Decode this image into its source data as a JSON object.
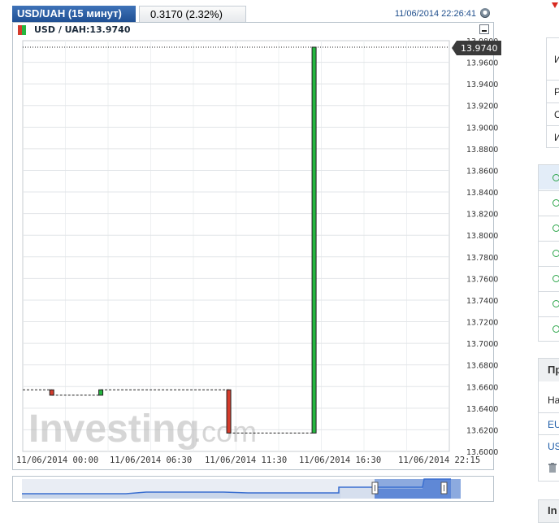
{
  "header": {
    "pair_tab": "USD/UAH (15 минут)",
    "change_tab": "0.3170 (2.32%)",
    "timestamp": "11/06/2014 22:26:41"
  },
  "legend": {
    "label": "USD / UAH:13.9740"
  },
  "price_badge": "13.9740",
  "watermark": {
    "brand": "Investing",
    "suffix": ".com"
  },
  "colors": {
    "up": "#25b63f",
    "down": "#d43b2b",
    "tab_active": "#2a5fa5",
    "badge": "#3a3a3a"
  },
  "icons": [
    "radio-icon",
    "minimize-icon",
    "trash-icon",
    "clock-icon"
  ],
  "chart_data": {
    "type": "candlestick",
    "y_ticks": [
      "13.6000",
      "13.6200",
      "13.6400",
      "13.6600",
      "13.6800",
      "13.7000",
      "13.7200",
      "13.7400",
      "13.7600",
      "13.7800",
      "13.8000",
      "13.8200",
      "13.8400",
      "13.8600",
      "13.8800",
      "13.9000",
      "13.9200",
      "13.9400",
      "13.9600",
      "13.9800"
    ],
    "x_ticks": [
      "11/06/2014 00:00",
      "11/06/2014 06:30",
      "11/06/2014 11:30",
      "11/06/2014 16:30",
      "11/06/2014 22:15"
    ],
    "ylim": [
      13.6,
      13.98
    ],
    "last_price": 13.974,
    "candles": [
      {
        "x": 0.068,
        "open": 13.657,
        "close": 13.652,
        "high": 13.657,
        "low": 13.652
      },
      {
        "x": 0.183,
        "open": 13.652,
        "close": 13.657,
        "high": 13.657,
        "low": 13.652
      },
      {
        "x": 0.483,
        "open": 13.657,
        "close": 13.617,
        "high": 13.657,
        "low": 13.617
      },
      {
        "x": 0.683,
        "open": 13.617,
        "close": 13.974,
        "high": 13.974,
        "low": 13.617
      }
    ]
  },
  "right_panel": {
    "row_letters": [
      "И",
      "Р",
      "С",
      "И"
    ],
    "section_title": "Пр",
    "sub_label": "На",
    "links": [
      "EU",
      "US"
    ],
    "bottom_label": "In"
  }
}
